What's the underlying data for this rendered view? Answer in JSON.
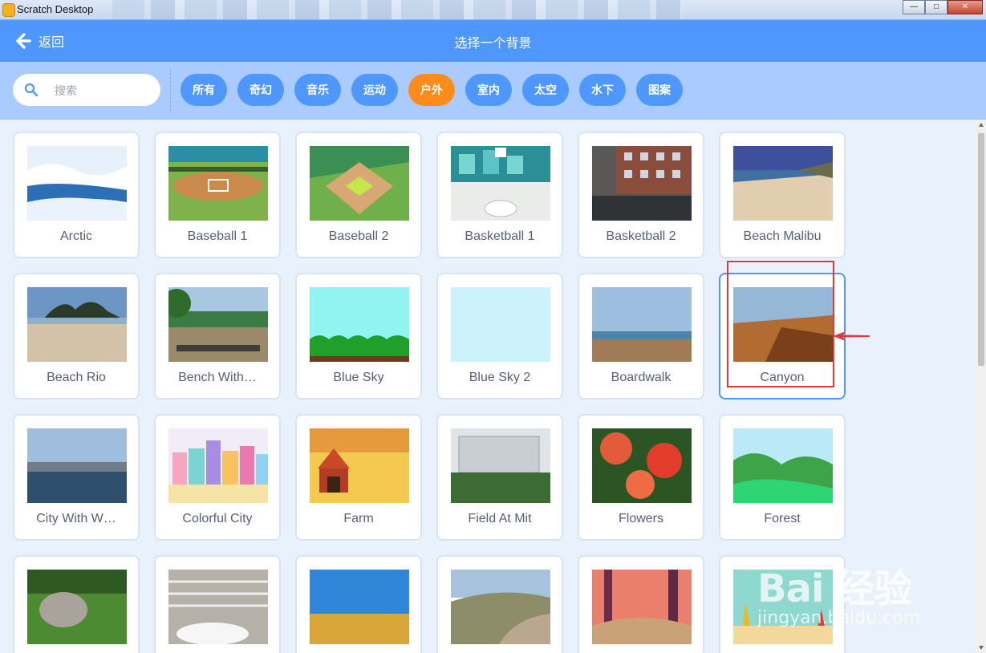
{
  "window": {
    "title": "Scratch Desktop",
    "minimize": "—",
    "maximize": "□",
    "close": "✕"
  },
  "header": {
    "back_label": "返回",
    "title": "选择一个背景"
  },
  "search": {
    "placeholder": "搜索",
    "value": ""
  },
  "tags": [
    {
      "label": "所有",
      "active": false
    },
    {
      "label": "奇幻",
      "active": false
    },
    {
      "label": "音乐",
      "active": false
    },
    {
      "label": "运动",
      "active": false
    },
    {
      "label": "户外",
      "active": true
    },
    {
      "label": "室内",
      "active": false
    },
    {
      "label": "太空",
      "active": false
    },
    {
      "label": "水下",
      "active": false
    },
    {
      "label": "图案",
      "active": false
    }
  ],
  "backdrops": [
    {
      "name": "Arctic",
      "icon": "arctic-icon"
    },
    {
      "name": "Baseball 1",
      "icon": "baseball-icon"
    },
    {
      "name": "Baseball 2",
      "icon": "baseball-icon"
    },
    {
      "name": "Basketball 1",
      "icon": "basketball-icon"
    },
    {
      "name": "Basketball 2",
      "icon": "basketball-icon"
    },
    {
      "name": "Beach Malibu",
      "icon": "beach-icon"
    },
    {
      "name": "Beach Rio",
      "icon": "beach-icon"
    },
    {
      "name": "Bench With…",
      "icon": "bench-icon"
    },
    {
      "name": "Blue Sky",
      "icon": "sky-icon"
    },
    {
      "name": "Blue Sky 2",
      "icon": "sky-icon"
    },
    {
      "name": "Boardwalk",
      "icon": "boardwalk-icon"
    },
    {
      "name": "Canyon",
      "icon": "canyon-icon",
      "selected": true
    },
    {
      "name": "City With W…",
      "icon": "city-icon"
    },
    {
      "name": "Colorful City",
      "icon": "city-icon"
    },
    {
      "name": "Farm",
      "icon": "farm-icon"
    },
    {
      "name": "Field At Mit",
      "icon": "field-icon"
    },
    {
      "name": "Flowers",
      "icon": "flowers-icon"
    },
    {
      "name": "Forest",
      "icon": "forest-icon"
    },
    {
      "name": "",
      "icon": "rock-icon"
    },
    {
      "name": "",
      "icon": "steps-icon"
    },
    {
      "name": "",
      "icon": "hay-field-icon"
    },
    {
      "name": "",
      "icon": "hill-icon"
    },
    {
      "name": "",
      "icon": "jungle-icon"
    },
    {
      "name": "",
      "icon": "jurassic-icon"
    }
  ],
  "watermark": {
    "brand": "Bai 经验",
    "url": "jingyan.baidu.com"
  },
  "colors": {
    "header": "#4d97ff",
    "active_tag": "#ff8c1a",
    "tag": "#4d97ff",
    "filterbar": "#a9cbff",
    "highlight": "#e03a3a"
  }
}
